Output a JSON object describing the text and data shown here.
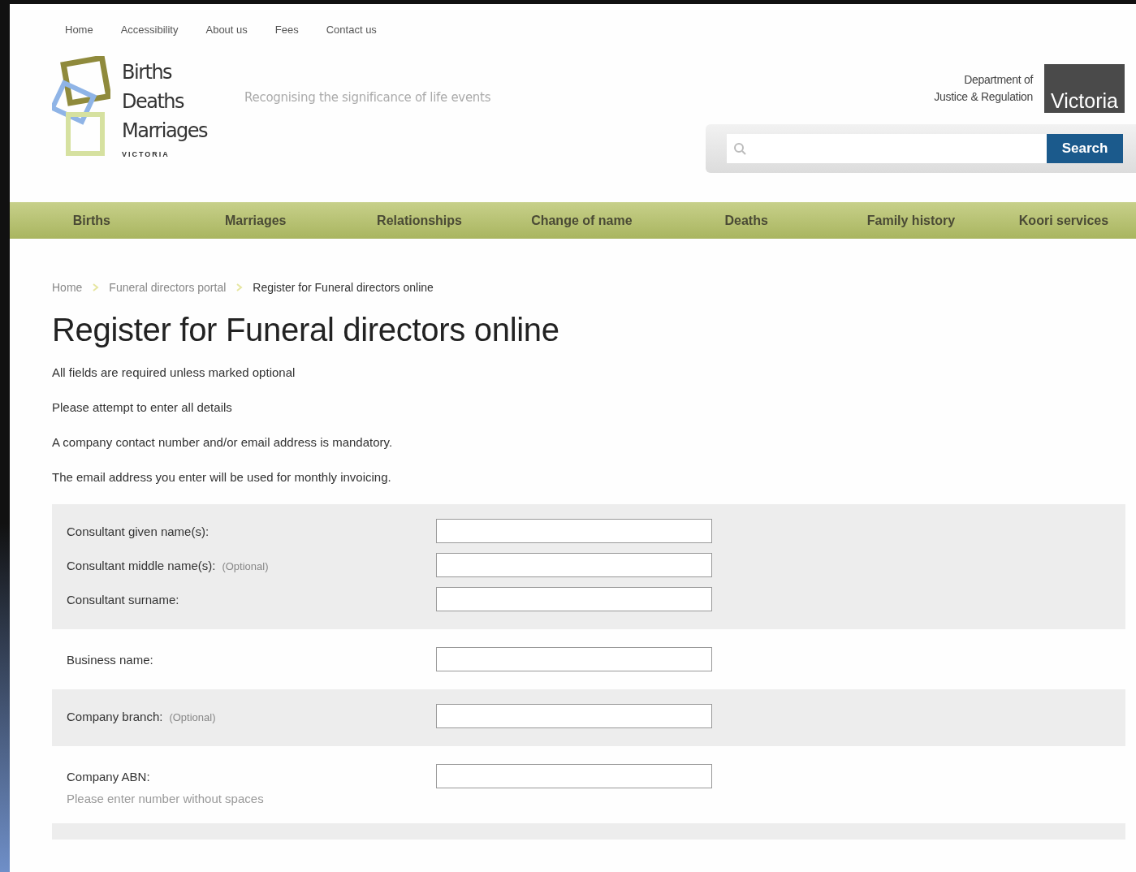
{
  "utility_nav": [
    {
      "label": "Home"
    },
    {
      "label": "Accessibility"
    },
    {
      "label": "About us"
    },
    {
      "label": "Fees"
    },
    {
      "label": "Contact us"
    }
  ],
  "logo": {
    "lines": [
      "Births",
      "Deaths",
      "Marriages"
    ],
    "sub": "VICTORIA"
  },
  "tagline": "Recognising the significance of life events",
  "department": {
    "lines": [
      "Department of",
      "Justice & Regulation"
    ],
    "state_logo": "Victoria"
  },
  "search": {
    "button": "Search"
  },
  "main_nav": [
    {
      "label": "Births"
    },
    {
      "label": "Marriages"
    },
    {
      "label": "Relationships"
    },
    {
      "label": "Change of name"
    },
    {
      "label": "Deaths"
    },
    {
      "label": "Family history"
    },
    {
      "label": "Koori services"
    }
  ],
  "breadcrumb": [
    {
      "label": "Home",
      "link": true
    },
    {
      "label": "Funeral directors portal",
      "link": true
    },
    {
      "label": "Register for Funeral directors online",
      "link": false
    }
  ],
  "title": "Register for Funeral directors online",
  "intro": [
    "All fields are required unless marked optional",
    "Please attempt to enter all details",
    "A company contact number and/or email address is mandatory.",
    "The email address you enter will be used for monthly invoicing."
  ],
  "form_groups": [
    {
      "shaded": true,
      "fields": [
        {
          "label": "Consultant given name(s):"
        },
        {
          "label": "Consultant middle name(s):",
          "optional": "(Optional)"
        },
        {
          "label": "Consultant surname:"
        }
      ]
    },
    {
      "shaded": false,
      "fields": [
        {
          "label": "Business name:"
        }
      ]
    },
    {
      "shaded": true,
      "fields": [
        {
          "label": "Company branch:",
          "optional": "(Optional)"
        }
      ]
    },
    {
      "shaded": false,
      "fields": [
        {
          "label": "Company ABN:",
          "hint": "Please enter number without spaces"
        }
      ]
    },
    {
      "shaded": true
    }
  ]
}
